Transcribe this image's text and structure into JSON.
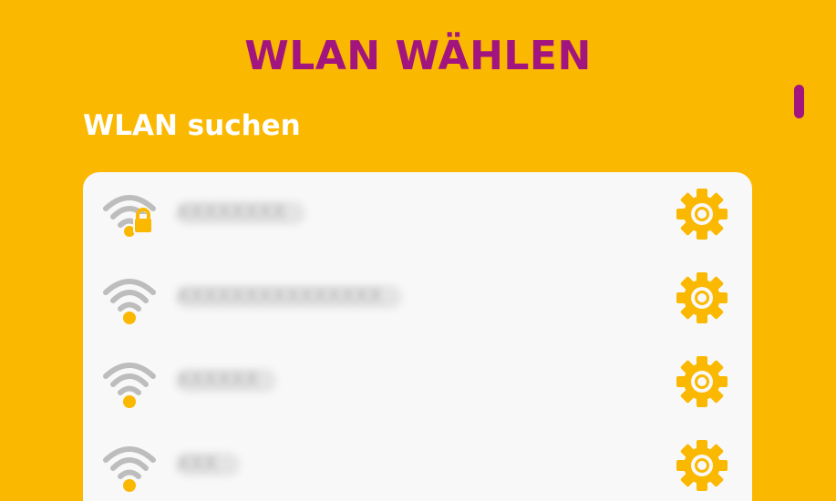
{
  "header": {
    "title": "WLAN WÄHLEN",
    "subtitle": "WLAN suchen"
  },
  "networks": [
    {
      "ssid": "XXXXXXXX",
      "secured": true,
      "icon": "wifi-locked-icon",
      "settings_icon": "gear-icon"
    },
    {
      "ssid": "XXXXXXXXXXXXXXX",
      "secured": false,
      "icon": "wifi-icon",
      "settings_icon": "gear-icon"
    },
    {
      "ssid": "XXXXXX",
      "secured": false,
      "icon": "wifi-icon",
      "settings_icon": "gear-icon"
    },
    {
      "ssid": "XXX",
      "secured": false,
      "icon": "wifi-icon",
      "settings_icon": "gear-icon"
    }
  ],
  "colors": {
    "background": "#FBB800",
    "accent": "#A3157E",
    "card": "#F8F8F8",
    "icon_gray": "#BDBDBD",
    "icon_yellow": "#FBB800"
  }
}
